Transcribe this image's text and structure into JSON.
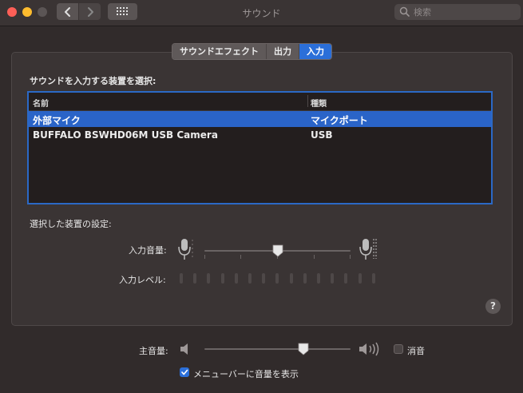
{
  "window": {
    "title": "サウンド",
    "search_placeholder": "検索"
  },
  "tabs": [
    {
      "label": "サウンドエフェクト",
      "active": false
    },
    {
      "label": "出力",
      "active": false
    },
    {
      "label": "入力",
      "active": true
    }
  ],
  "input": {
    "select_device_label": "サウンドを入力する装置を選択:",
    "table": {
      "columns": [
        "名前",
        "種類"
      ],
      "rows": [
        {
          "name": "外部マイク",
          "type": "マイクポート",
          "selected": true
        },
        {
          "name": "BUFFALO BSWHD06M USB Camera",
          "type": "USB",
          "selected": false
        }
      ]
    },
    "device_settings_label": "選択した装置の設定:",
    "input_volume_label": "入力音量:",
    "input_volume": 0.5,
    "input_level_label": "入力レベル:",
    "input_level_segments": 15,
    "input_level_active": 0
  },
  "help_label": "?",
  "output_volume_label": "主音量:",
  "output_volume": 0.68,
  "mute_label": "消音",
  "mute_checked": false,
  "show_in_menubar_label": "メニューバーに音量を表示",
  "show_in_menubar_checked": true,
  "colors": {
    "accent": "#2b6fd9",
    "background": "#312b2b"
  }
}
